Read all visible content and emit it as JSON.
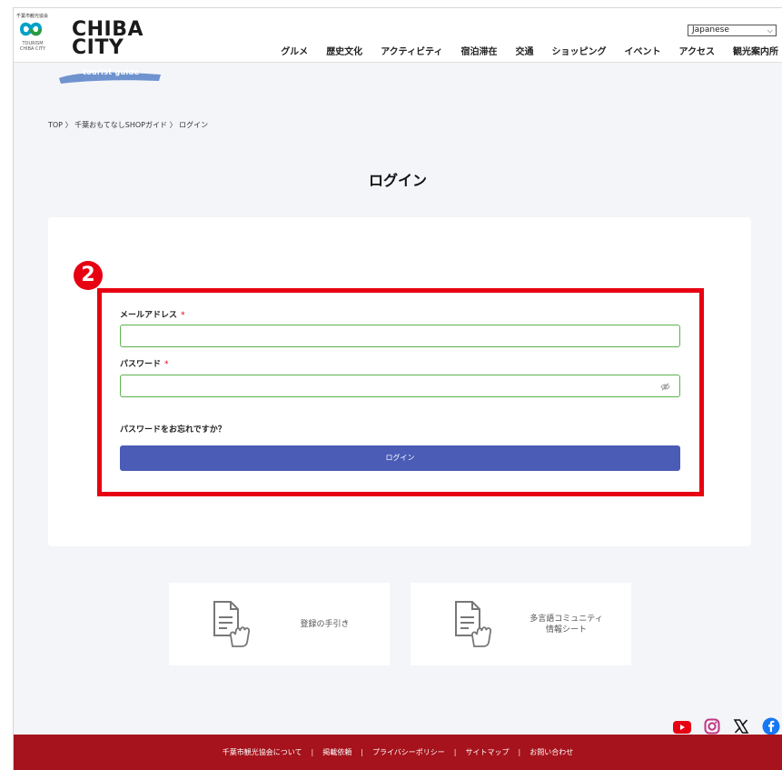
{
  "header": {
    "org_tiny": "千葉市観光協会",
    "tourism_line1": "TOURISM",
    "tourism_line2": "CHIBA CITY",
    "logo_line1": "CHIBA",
    "logo_line2": "CITY",
    "logo_sub": "tourist guide",
    "language": "Japanese",
    "nav": [
      "グルメ",
      "歴史文化",
      "アクティビティ",
      "宿泊滞在",
      "交通",
      "ショッピング",
      "イベント",
      "アクセス",
      "観光案内所"
    ]
  },
  "breadcrumb": {
    "home": "TOP",
    "sep": "〉",
    "section": "千葉おもてなしSHOPガイド",
    "current": "ログイン"
  },
  "page_title": "ログイン",
  "form": {
    "badge": "2",
    "email_label": "メールアドレス",
    "password_label": "パスワード",
    "required_mark": "*",
    "email_value": "",
    "password_value": "",
    "forgot_link": "パスワードをお忘れですか？",
    "login_button": "ログイン"
  },
  "guides": [
    {
      "line1": "登録の手引き",
      "line2": ""
    },
    {
      "line1": "多言語コミュニティ",
      "line2": "情報シート"
    }
  ],
  "social": [
    "youtube-icon",
    "instagram-icon",
    "x-icon",
    "facebook-icon"
  ],
  "footer": {
    "links": [
      "千葉市観光協会について",
      "掲載依頼",
      "プライバシーポリシー",
      "サイトマップ",
      "お問い合わせ"
    ],
    "sep": "|"
  },
  "colors": {
    "accent_red": "#e60012",
    "button_blue": "#4a5cb6",
    "field_border": "#5ab34a",
    "footer_bg": "#a6131c",
    "brush_blue": "#6f93cf"
  }
}
